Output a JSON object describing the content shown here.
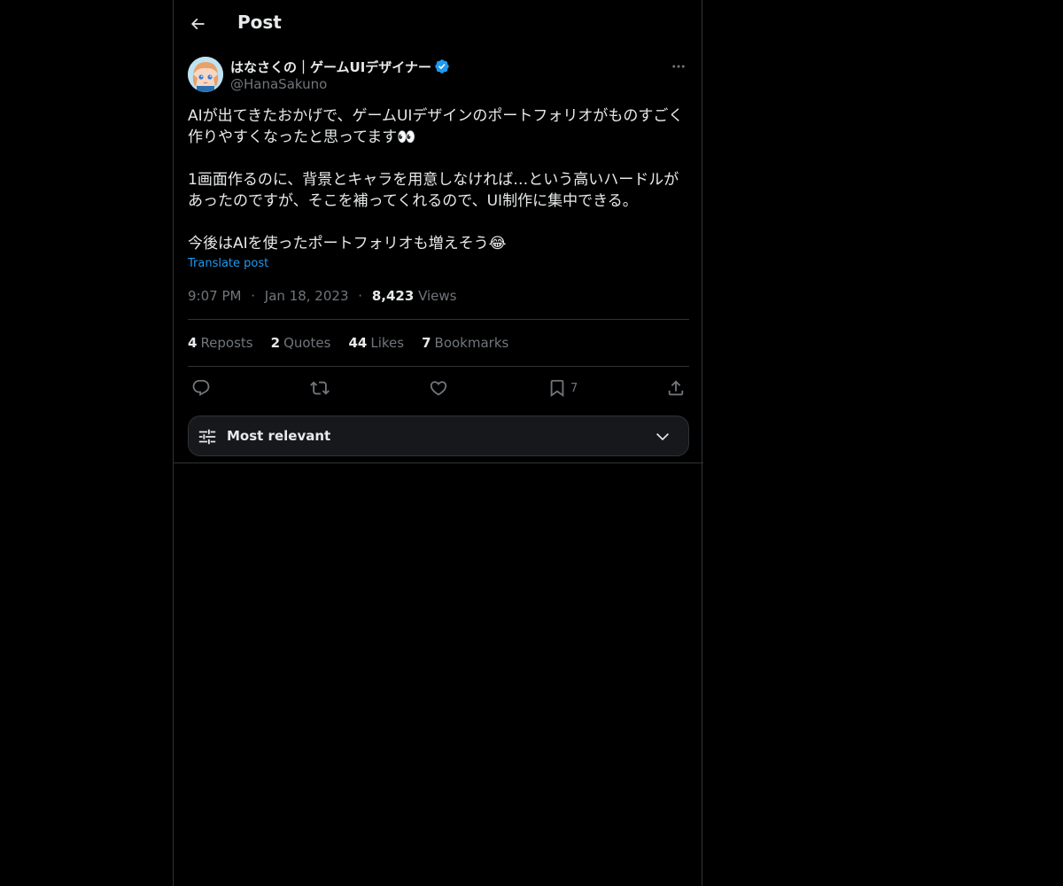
{
  "header": {
    "title": "Post"
  },
  "post": {
    "author": {
      "name": "はなさくの｜ゲームUIデザイナー",
      "handle": "@HanaSakuno",
      "verified": true
    },
    "text": "AIが出てきたおかげで、ゲームUIデザインのポートフォリオがものすごく作りやすくなったと思ってます👀\n\n1画面作るのに、背景とキャラを用意しなければ…という高いハードルがあったのですが、そこを補ってくれるので、UI制作に集中できる。\n\n今後はAIを使ったポートフォリオも増えそう😂",
    "translate_label": "Translate post",
    "time": "9:07 PM",
    "date": "Jan 18, 2023",
    "separator": "·",
    "views_count": "8,423",
    "views_label": "Views"
  },
  "stats": {
    "reposts_count": "4",
    "reposts_label": "Reposts",
    "quotes_count": "2",
    "quotes_label": "Quotes",
    "likes_count": "44",
    "likes_label": "Likes",
    "bookmarks_count": "7",
    "bookmarks_label": "Bookmarks"
  },
  "actions": {
    "bookmark_count": "7"
  },
  "sort": {
    "label": "Most relevant"
  },
  "colors": {
    "background": "#000000",
    "text": "#e7e9ea",
    "muted": "#71767b",
    "accent": "#1d9bf0",
    "border": "#2f3336"
  },
  "icons": {
    "back": "arrow-left-icon",
    "verified": "verified-badge-icon",
    "more": "more-horizontal-icon",
    "reply": "reply-icon",
    "repost": "repost-icon",
    "like": "heart-icon",
    "bookmark": "bookmark-icon",
    "share": "share-icon",
    "sort": "sliders-icon",
    "chevron": "chevron-down-icon"
  }
}
